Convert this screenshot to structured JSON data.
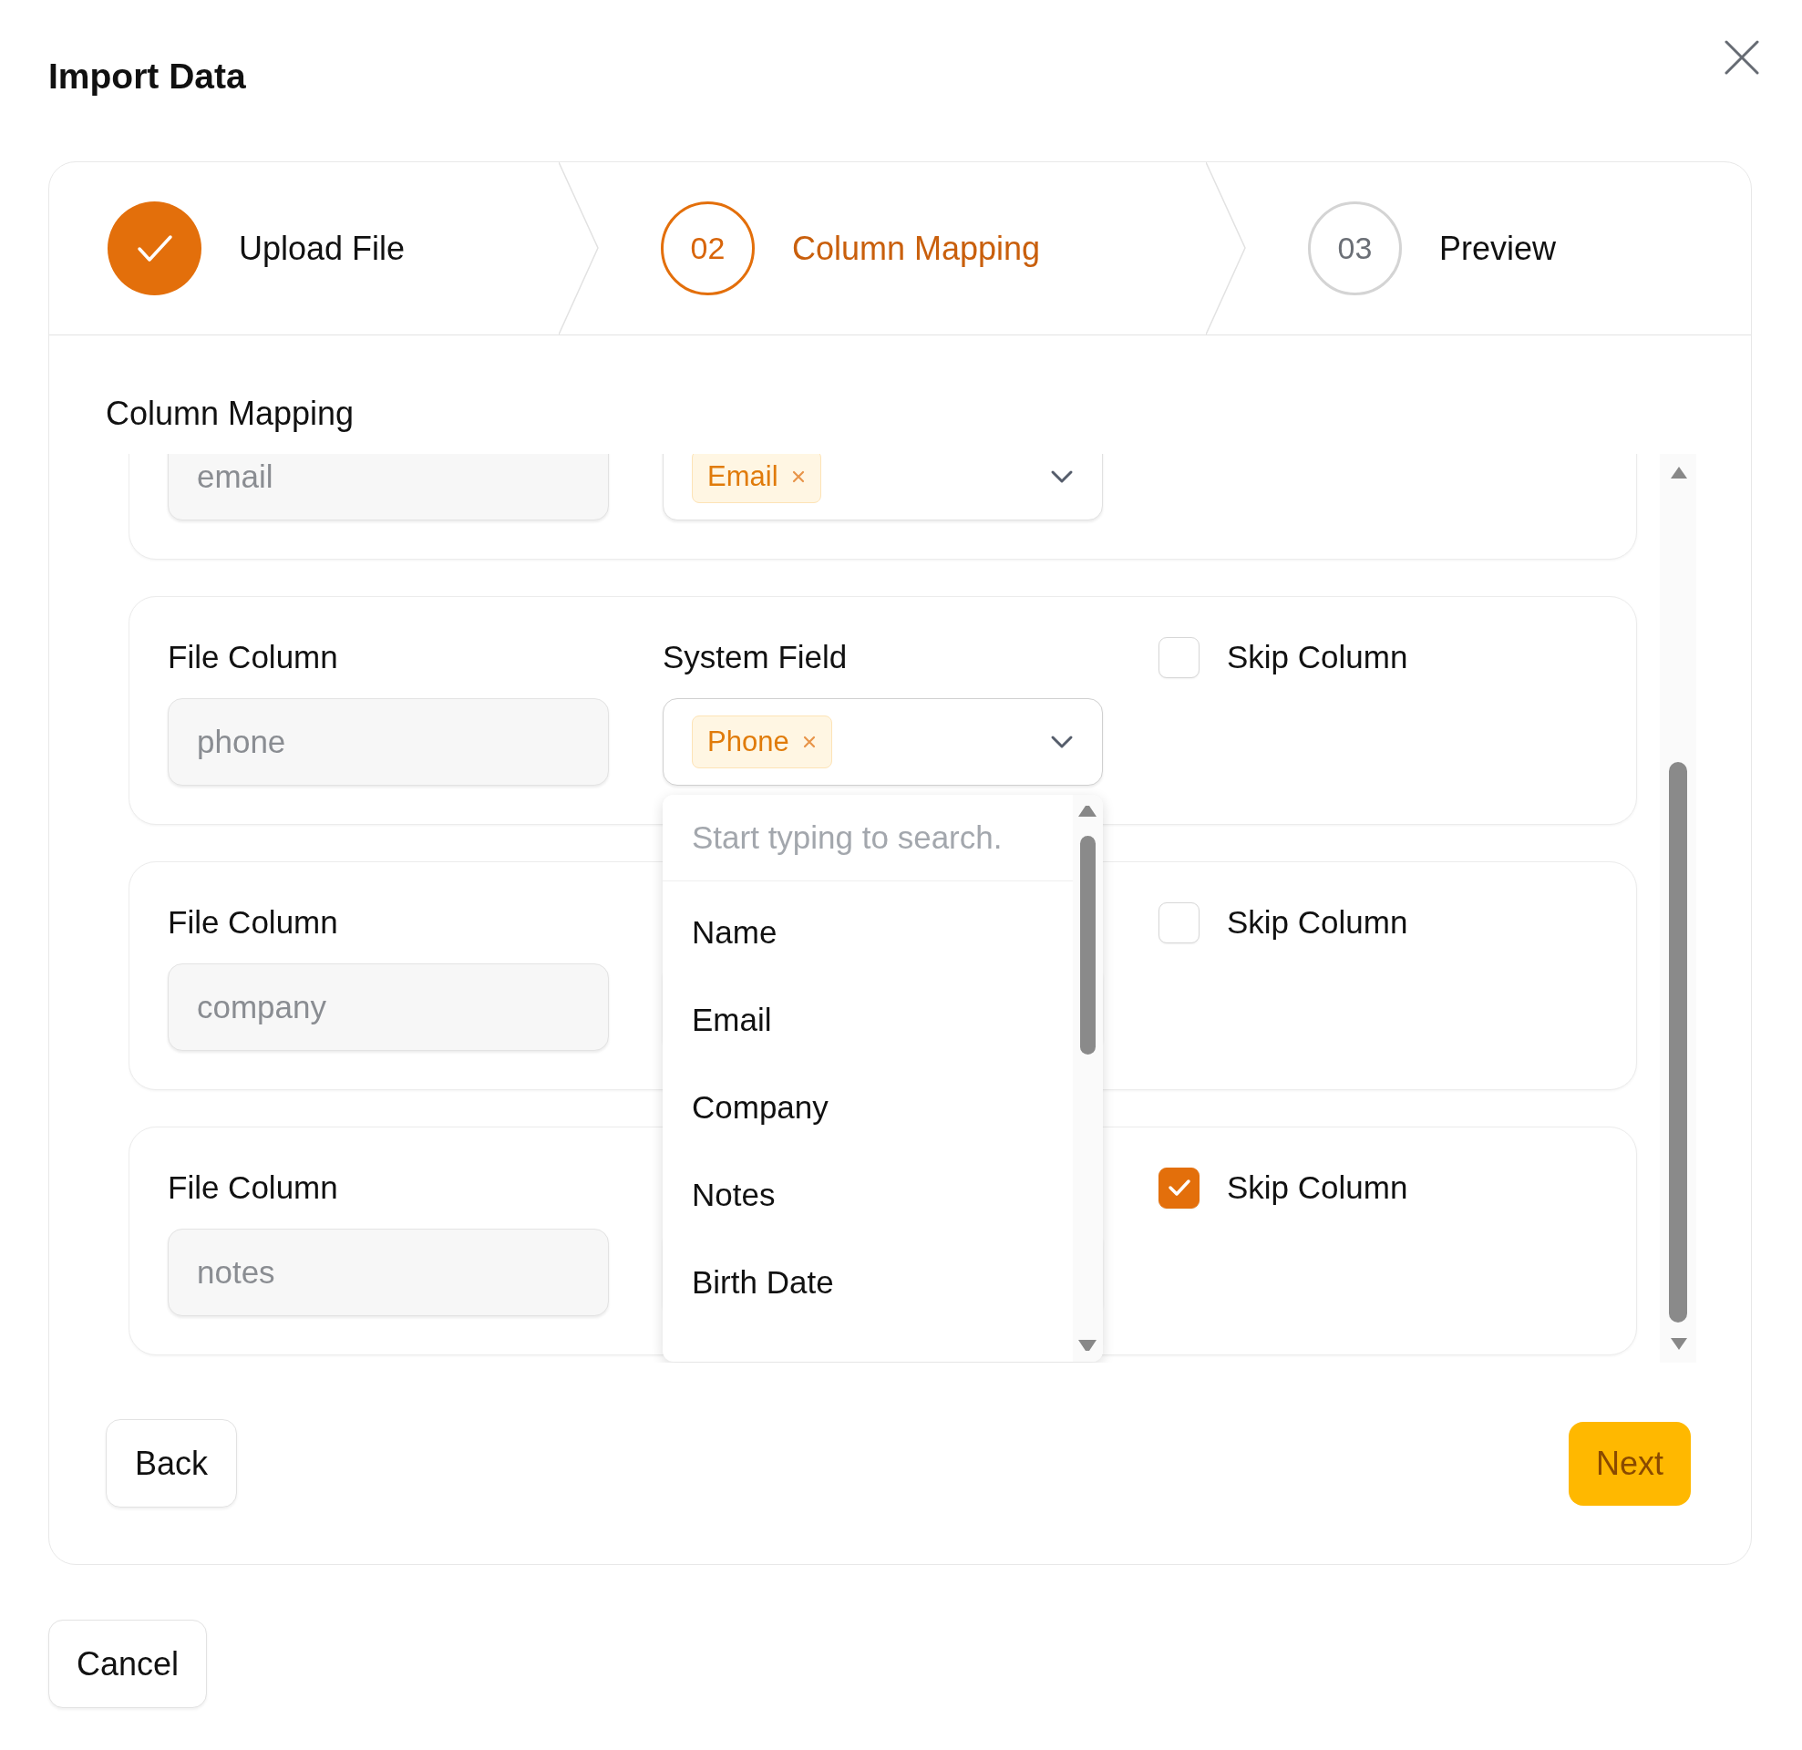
{
  "dialog": {
    "title": "Import Data"
  },
  "steps": [
    {
      "kind": "done",
      "label": "Upload File"
    },
    {
      "kind": "current",
      "number": "02",
      "label": "Column Mapping"
    },
    {
      "kind": "upcoming",
      "number": "03",
      "label": "Preview"
    }
  ],
  "section_title": "Column Mapping",
  "rows": [
    {
      "file_value": "email",
      "field_tag": "Email",
      "open": false
    },
    {
      "file_label": "File Column",
      "file_value": "phone",
      "field_label": "System Field",
      "field_tag": "Phone",
      "skip_label": "Skip Column",
      "skip": false,
      "open": true
    },
    {
      "file_label": "File Column",
      "file_value": "company",
      "skip_label": "Skip Column",
      "skip": false,
      "open": false
    },
    {
      "file_label": "File Column",
      "file_value": "notes",
      "skip_label": "Skip Column",
      "skip": true,
      "open": false
    }
  ],
  "dropdown": {
    "placeholder": "Start typing to search.",
    "options": [
      "Name",
      "Email",
      "Company",
      "Notes",
      "Birth Date"
    ]
  },
  "buttons": {
    "back": "Back",
    "next": "Next",
    "cancel": "Cancel"
  }
}
